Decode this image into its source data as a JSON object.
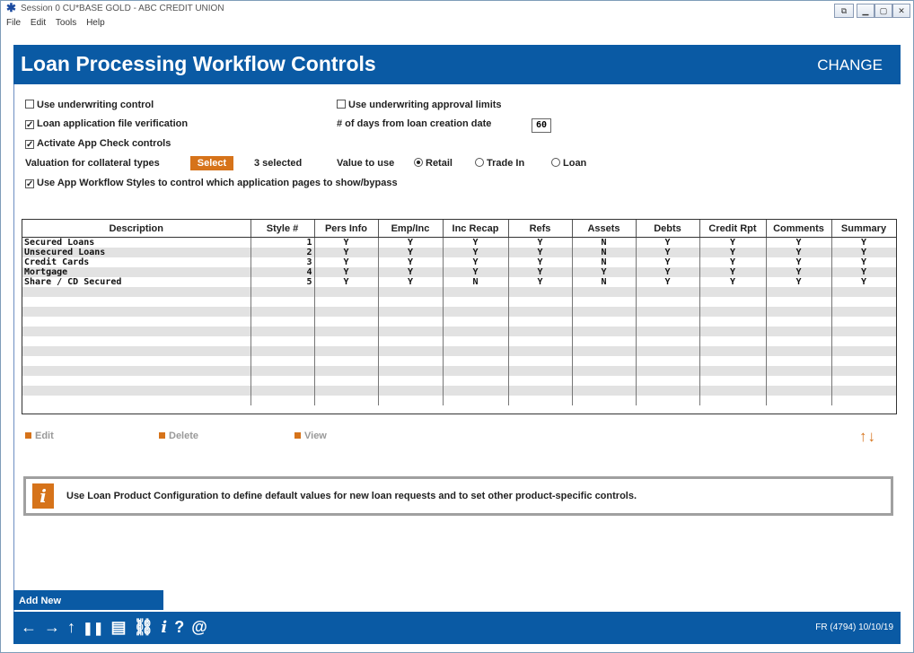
{
  "window": {
    "title": "Session 0 CU*BASE GOLD - ABC CREDIT UNION",
    "menu": [
      "File",
      "Edit",
      "Tools",
      "Help"
    ]
  },
  "header": {
    "title": "Loan Processing Workflow Controls",
    "mode": "CHANGE"
  },
  "options": {
    "use_underwriting_control": "Use underwriting control",
    "loan_app_file_verification": "Loan application file verification",
    "activate_app_check": "Activate App Check controls",
    "valuation_label": "Valuation for collateral types",
    "select_button": "Select",
    "selected_count": "3 selected",
    "use_app_workflow_styles": "Use App Workflow Styles to control which application pages to show/bypass",
    "use_underwriting_approval_limits": "Use underwriting approval limits",
    "days_label": "# of days from loan creation date",
    "days_value": "60",
    "value_to_use_label": "Value to use",
    "radio_retail": "Retail",
    "radio_trade_in": "Trade In",
    "radio_loan": "Loan"
  },
  "grid": {
    "columns": [
      "Description",
      "Style #",
      "Pers Info",
      "Emp/Inc",
      "Inc Recap",
      "Refs",
      "Assets",
      "Debts",
      "Credit Rpt",
      "Comments",
      "Summary"
    ],
    "rows": [
      [
        "Secured Loans",
        "1",
        "Y",
        "Y",
        "Y",
        "Y",
        "N",
        "Y",
        "Y",
        "Y",
        "Y"
      ],
      [
        "Unsecured Loans",
        "2",
        "Y",
        "Y",
        "Y",
        "Y",
        "N",
        "Y",
        "Y",
        "Y",
        "Y"
      ],
      [
        "Credit Cards",
        "3",
        "Y",
        "Y",
        "Y",
        "Y",
        "N",
        "Y",
        "Y",
        "Y",
        "Y"
      ],
      [
        "Mortgage",
        "4",
        "Y",
        "Y",
        "Y",
        "Y",
        "Y",
        "Y",
        "Y",
        "Y",
        "Y"
      ],
      [
        "Share / CD Secured",
        "5",
        "Y",
        "Y",
        "N",
        "Y",
        "N",
        "Y",
        "Y",
        "Y",
        "Y"
      ]
    ]
  },
  "actions": {
    "edit": "Edit",
    "delete": "Delete",
    "view": "View"
  },
  "info": {
    "message": "Use Loan Product Configuration to define default values for new loan requests and to set other product-specific controls."
  },
  "add_new": "Add New",
  "footer": {
    "status": "FR (4794) 10/10/19"
  }
}
